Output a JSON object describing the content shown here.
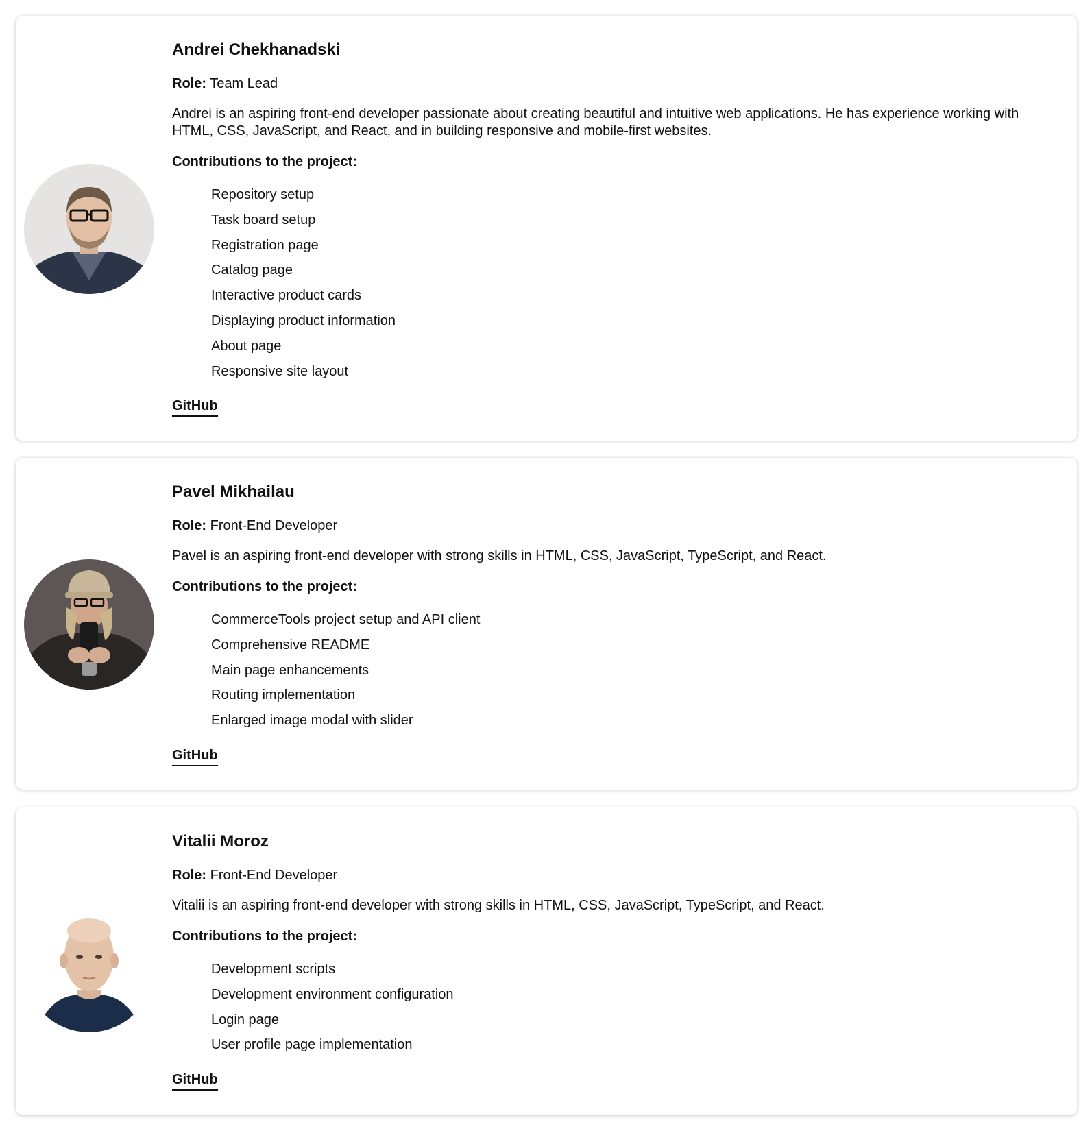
{
  "members": [
    {
      "name": "Andrei Chekhanadski",
      "role_label": "Role:",
      "role": "Team Lead",
      "bio": "Andrei is an aspiring front-end developer passionate about creating beautiful and intuitive web applications. He has experience working with HTML, CSS, JavaScript, and React, and in building responsive and mobile-first websites.",
      "contributions_title": "Contributions to the project:",
      "contributions": [
        "Repository setup",
        "Task board setup",
        "Registration page",
        "Catalog page",
        "Interactive product cards",
        "Displaying product information",
        "About page",
        "Responsive site layout"
      ],
      "github_label": "GitHub"
    },
    {
      "name": "Pavel Mikhailau",
      "role_label": "Role:",
      "role": "Front-End Developer",
      "bio": "Pavel is an aspiring front-end developer with strong skills in HTML, CSS, JavaScript, TypeScript, and React.",
      "contributions_title": "Contributions to the project:",
      "contributions": [
        "CommerceTools project setup and API client",
        "Comprehensive README",
        "Main page enhancements",
        "Routing implementation",
        "Enlarged image modal with slider"
      ],
      "github_label": "GitHub"
    },
    {
      "name": "Vitalii Moroz",
      "role_label": "Role:",
      "role": "Front-End Developer",
      "bio": "Vitalii is an aspiring front-end developer with strong skills in HTML, CSS, JavaScript, TypeScript, and React.",
      "contributions_title": "Contributions to the project:",
      "contributions": [
        "Development scripts",
        "Development environment configuration",
        "Login page",
        "User profile page implementation"
      ],
      "github_label": "GitHub"
    }
  ]
}
